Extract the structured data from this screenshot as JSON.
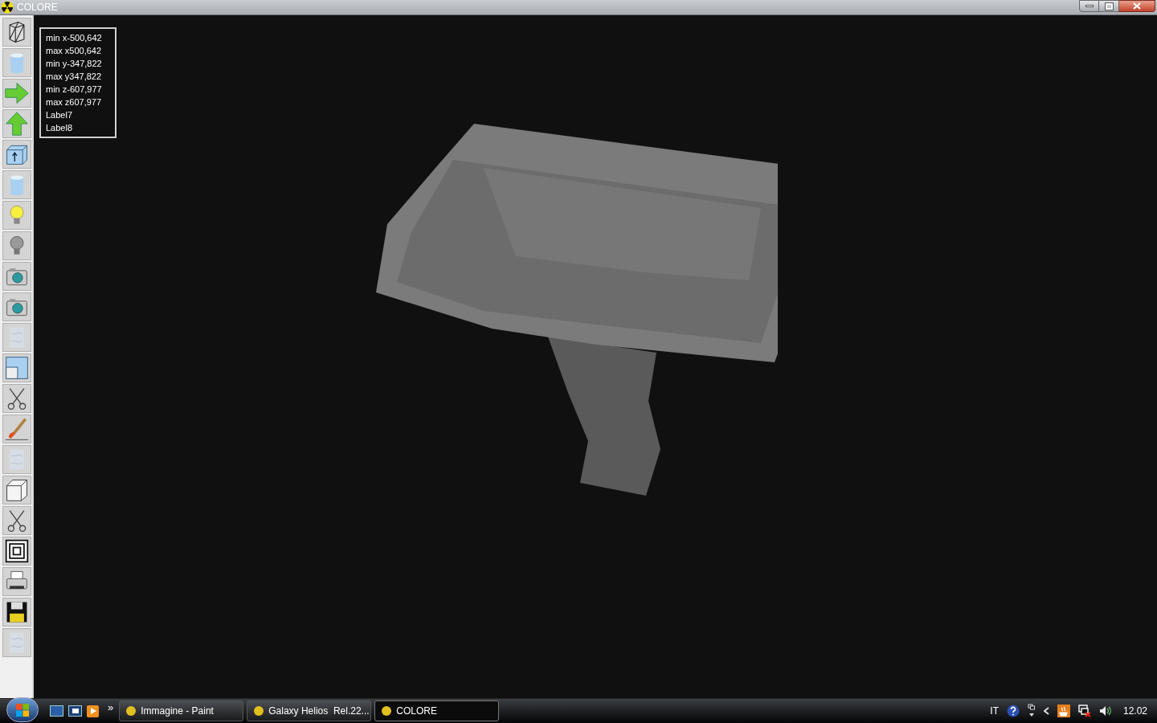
{
  "window": {
    "title": "COLORE"
  },
  "toolbar": [
    {
      "kind": "wireframe"
    },
    {
      "kind": "cylinder"
    },
    {
      "kind": "arrow-right"
    },
    {
      "kind": "arrow-up"
    },
    {
      "kind": "cube-arrow"
    },
    {
      "kind": "cylinder"
    },
    {
      "kind": "bulb-on"
    },
    {
      "kind": "bulb-off"
    },
    {
      "kind": "camera"
    },
    {
      "kind": "camera"
    },
    {
      "kind": "marble"
    },
    {
      "kind": "panes"
    },
    {
      "kind": "scissors"
    },
    {
      "kind": "brush"
    },
    {
      "kind": "marble"
    },
    {
      "kind": "cube"
    },
    {
      "kind": "scissors"
    },
    {
      "kind": "squares"
    },
    {
      "kind": "printer"
    },
    {
      "kind": "floppy"
    },
    {
      "kind": "marble"
    }
  ],
  "info_labels": [
    "min x-500,642",
    "max x500,642",
    "min y-347,822",
    "max y347,822",
    "min z-607,977",
    "max z607,977",
    "Label7",
    "Label8"
  ],
  "taskbar": {
    "overflow": "»",
    "tasks": [
      {
        "label": "Immagine - Paint",
        "selected": false
      },
      {
        "label": "Galaxy Helios  Rel.22...",
        "selected": false
      },
      {
        "label": "COLORE",
        "selected": true
      }
    ],
    "language": "IT",
    "clock": "12.02"
  }
}
